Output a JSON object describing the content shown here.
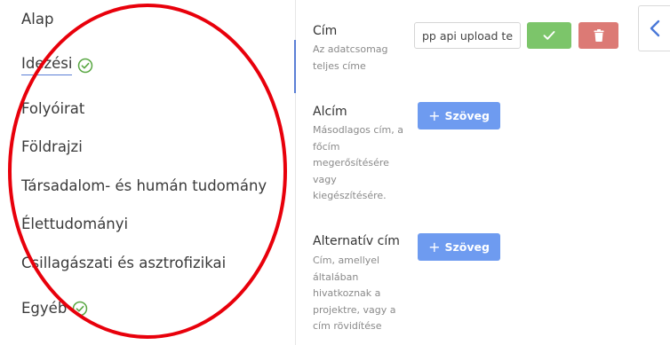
{
  "sidebar": {
    "items": [
      {
        "label": "Alap",
        "checked": false,
        "active": false
      },
      {
        "label": "Idezési",
        "checked": true,
        "active": true
      },
      {
        "label": "Folyóirat",
        "checked": false,
        "active": false
      },
      {
        "label": "Földrajzi",
        "checked": false,
        "active": false
      },
      {
        "label": "Társadalom- és humán tudomány",
        "checked": false,
        "active": false
      },
      {
        "label": "Élettudományi",
        "checked": false,
        "active": false
      },
      {
        "label": "Csillagászati és asztrofizikai",
        "checked": false,
        "active": false
      },
      {
        "label": "Egyéb",
        "checked": true,
        "active": false
      }
    ]
  },
  "fields": {
    "cim": {
      "label": "Cím",
      "description": "Az adatcsomag teljes címe",
      "value": "pp api upload te"
    },
    "alcim": {
      "label": "Alcím",
      "description": "Másodlagos cím, a főcím megerősítésére vagy kiegészítésére.",
      "add_label": "Szöveg"
    },
    "alternativ_cim": {
      "label": "Alternatív cím",
      "description": "Cím, amellyel általában hivatkoznak a projektre, vagy a cím rövidítése",
      "add_label": "Szöveg"
    }
  },
  "icons": {
    "check": "check-circle-icon",
    "confirm": "checkmark-icon",
    "delete": "trash-icon",
    "add": "plus-icon",
    "back": "chevron-left-icon"
  },
  "colors": {
    "accent": "#5b7fd6",
    "success": "#7cc56a",
    "danger": "#dc7a75",
    "primary_button": "#6e9bf0",
    "annotation": "#e8000b"
  }
}
